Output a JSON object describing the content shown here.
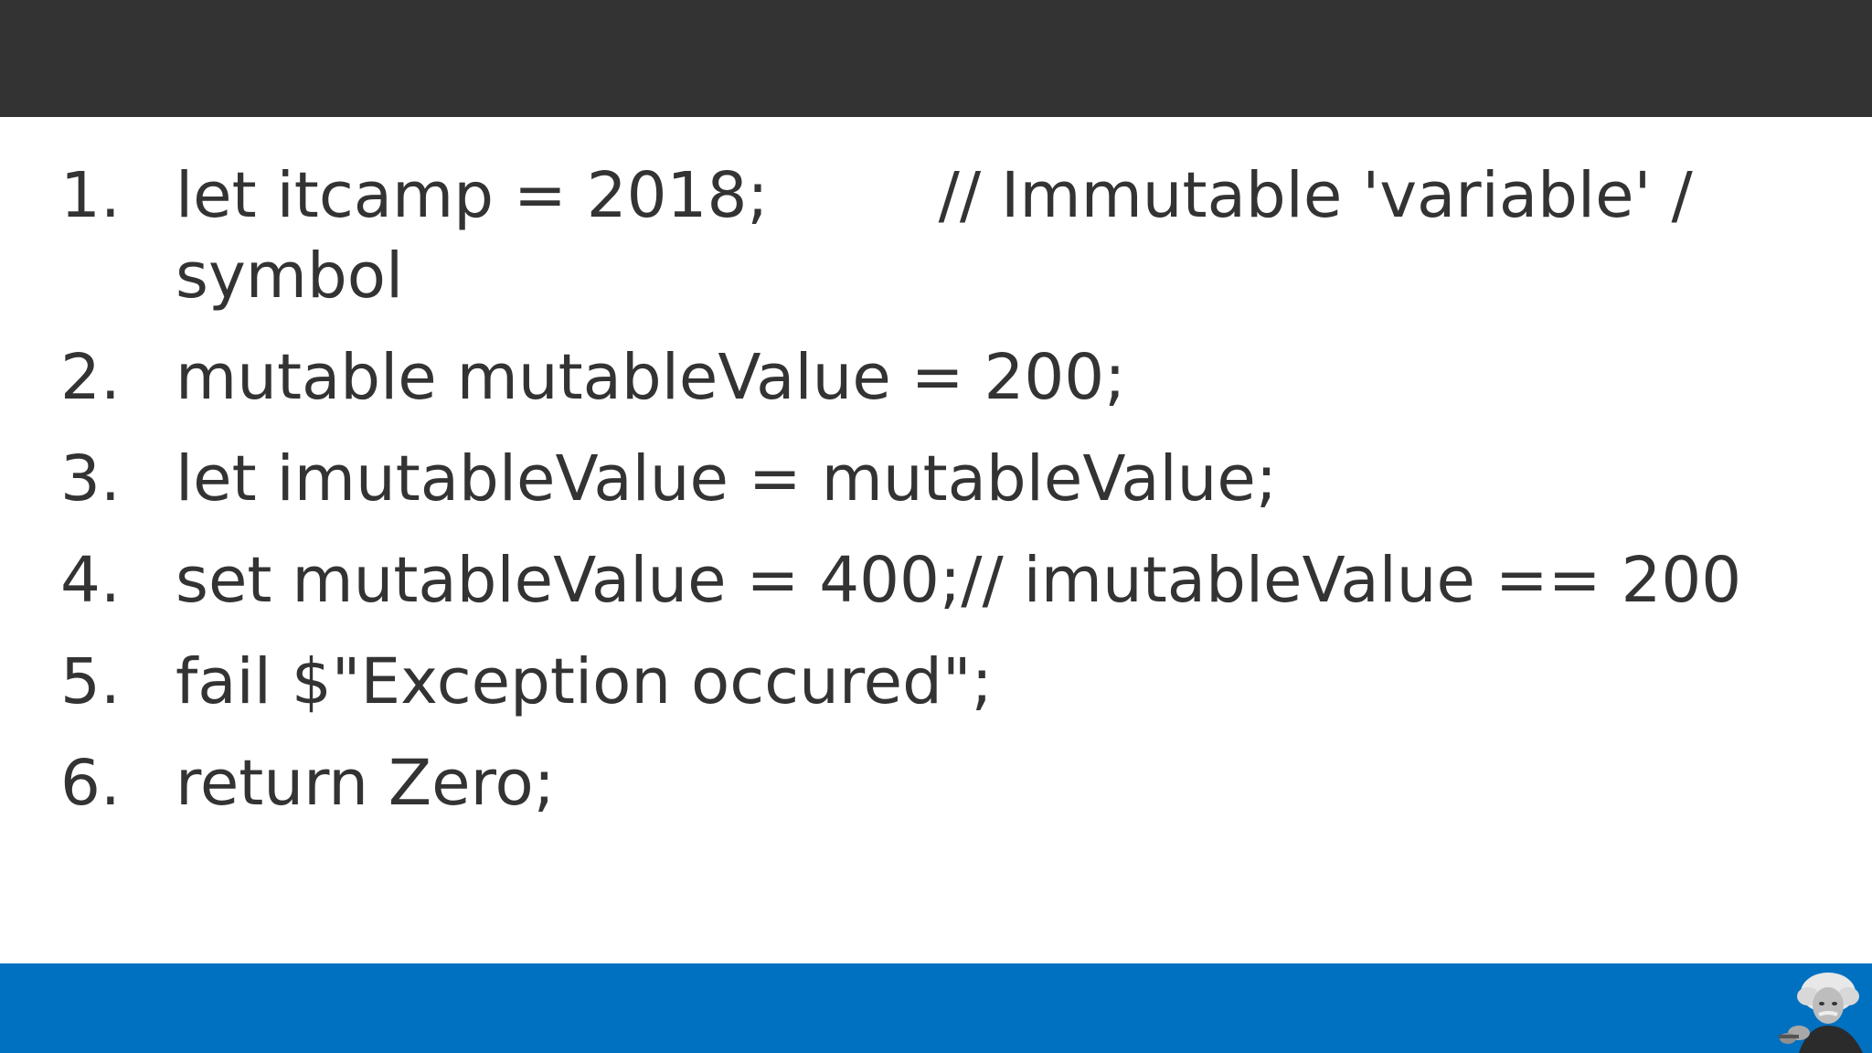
{
  "colors": {
    "top_bar": "#333333",
    "bottom_bar": "#0070c0",
    "text": "#333333",
    "background": "#ffffff"
  },
  "code_lines": [
    {
      "num": "1.",
      "code": "let itcamp = 2018;",
      "comment": "// Immutable 'variable' / symbol"
    },
    {
      "num": "2.",
      "code": "mutable mutableValue = 200;"
    },
    {
      "num": "3.",
      "code": "let imutableValue = mutableValue;"
    },
    {
      "num": "4.",
      "code": "set mutableValue = 400;// imutableValue == 200"
    },
    {
      "num": "5.",
      "code": "fail $\"Exception occured\";"
    },
    {
      "num": "6.",
      "code": "return Zero;"
    }
  ],
  "footer_icon": "einstein-portrait-icon"
}
